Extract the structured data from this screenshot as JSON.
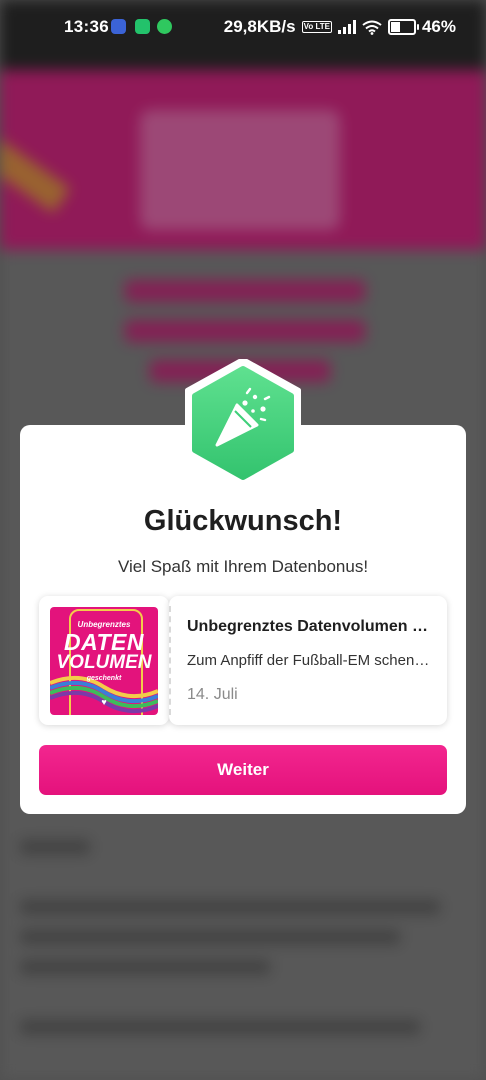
{
  "status_bar": {
    "time": "13:36",
    "network_speed": "29,8KB/s",
    "volte": "Vo LTE",
    "battery_percent": "46%",
    "battery_level": 0.46,
    "notification_icons": [
      "info-icon",
      "app-icon-green",
      "vpn-icon"
    ]
  },
  "dialog": {
    "badge_icon": "party-popper-icon",
    "title": "Glückwunsch!",
    "subtitle": "Viel Spaß mit Ihrem Datenbonus!",
    "card": {
      "thumbnail": {
        "line1": "Unbegrenztes",
        "line2": "DATEN",
        "line3": "VOLUMEN",
        "line4": "geschenkt",
        "heart": "♥"
      },
      "title": "Unbegrenztes Datenvolumen geschenkt",
      "description": "Zum Anpfiff der Fußball-EM schenken wir Ihnen unbegrenztes Datenvolumen",
      "date": "14. Juli"
    },
    "button_label": "Weiter"
  },
  "colors": {
    "brand_magenta": "#e4127c",
    "badge_green": "#3fcf7a",
    "background_dim": "#6f6f6f"
  }
}
